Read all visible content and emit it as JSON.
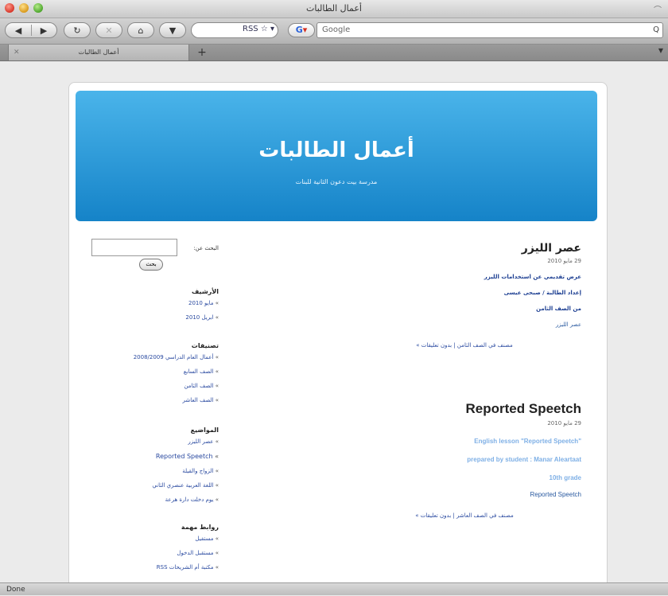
{
  "window": {
    "title": "أعمال الطالبات"
  },
  "toolbar": {
    "back_icon": "◀",
    "forward_icon": "▶",
    "reload_icon": "↻",
    "stop_icon": "✕",
    "home_icon": "⌂",
    "tabs_icon": "▼",
    "address_icons": "RSS ☆ ▾",
    "search_engine": "Google",
    "search_placeholder": "Google",
    "search_icon": "Q"
  },
  "tabs": [
    {
      "label": "أعمال الطالبات"
    }
  ],
  "newtab_icon": "+",
  "tab_overflow_icon": "▼",
  "site": {
    "title": "أعمال الطالبات",
    "description": "مدرسة بيت دعون الثانية للبنات"
  },
  "sidebar": {
    "search_label": "البحث عن:",
    "search_button": "بحث",
    "archives": {
      "title": "الأرشيف",
      "items": [
        "مايو 2010",
        "ابريل 2010"
      ]
    },
    "categories": {
      "title": "تصنيفات",
      "items": [
        "أعمال العام الدراسي 2008/2009",
        "الصف السابع",
        "الصف الثامن",
        "الصف العاشر"
      ]
    },
    "recent": {
      "title": "المواضيع",
      "items": [
        "عصر الليزر",
        "Reported Speetch",
        "الزواج والقيلة",
        "اللغة العربية عنصري الثاني",
        "يوم دخلت دارة هرعة"
      ]
    },
    "links": {
      "title": "روابط مهمة",
      "items": [
        "مستفيل",
        "مستقبل الدخول",
        "مكتبة أم الشريحات RSS"
      ]
    }
  },
  "posts": [
    {
      "title": "عصر الليزر",
      "date": "29 مايو 2010",
      "lines": [
        "عرض تقديمي عن استخدامات الليزر",
        "إعداد الطالبة / صبحى عيسى",
        "من الصف الثامن",
        "عصر الليزر"
      ],
      "meta": "مصنف في الصف الثامن | بدون تعليقات »"
    },
    {
      "title": "Reported Speetch",
      "date": "29 مايو 2010",
      "lines": [
        "\"English lesson \"Reported Speetch",
        "prepared by student : Manar Aleartaat",
        "10th grade",
        "Reported Speetch"
      ],
      "meta": "مصنف في الصف العاشر | بدون تعليقات »"
    }
  ],
  "status": {
    "text": "Done"
  }
}
